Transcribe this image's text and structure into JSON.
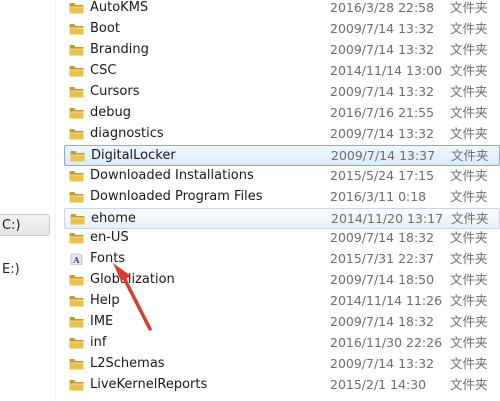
{
  "nav": {
    "items": [
      {
        "label": "C:)",
        "selected": true
      },
      {
        "label": "E:)",
        "selected": false
      }
    ]
  },
  "files": [
    {
      "name": "AutoKMS",
      "date": "2016/3/28 22:58",
      "type": "文件夹",
      "icon": "folder-icon",
      "state": ""
    },
    {
      "name": "Boot",
      "date": "2009/7/14 13:32",
      "type": "文件夹",
      "icon": "folder-icon",
      "state": ""
    },
    {
      "name": "Branding",
      "date": "2009/7/14 13:32",
      "type": "文件夹",
      "icon": "folder-icon",
      "state": ""
    },
    {
      "name": "CSC",
      "date": "2014/11/14 13:00",
      "type": "文件夹",
      "icon": "folder-icon",
      "state": ""
    },
    {
      "name": "Cursors",
      "date": "2009/7/14 13:32",
      "type": "文件夹",
      "icon": "folder-icon",
      "state": ""
    },
    {
      "name": "debug",
      "date": "2016/7/16 21:55",
      "type": "文件夹",
      "icon": "folder-icon",
      "state": ""
    },
    {
      "name": "diagnostics",
      "date": "2009/7/14 13:32",
      "type": "文件夹",
      "icon": "folder-icon",
      "state": ""
    },
    {
      "name": "DigitalLocker",
      "date": "2009/7/14 13:37",
      "type": "文件夹",
      "icon": "folder-icon",
      "state": "selected"
    },
    {
      "name": "Downloaded Installations",
      "date": "2015/5/24 17:15",
      "type": "文件夹",
      "icon": "folder-icon",
      "state": ""
    },
    {
      "name": "Downloaded Program Files",
      "date": "2016/3/11 0:18",
      "type": "文件夹",
      "icon": "folder-icon",
      "state": ""
    },
    {
      "name": "ehome",
      "date": "2014/11/20 13:17",
      "type": "文件夹",
      "icon": "folder-icon",
      "state": "hover"
    },
    {
      "name": "en-US",
      "date": "2009/7/14 18:32",
      "type": "文件夹",
      "icon": "folder-icon",
      "state": ""
    },
    {
      "name": "Fonts",
      "date": "2015/7/31 22:37",
      "type": "文件夹",
      "icon": "fonts-folder-icon",
      "state": ""
    },
    {
      "name": "Globalization",
      "date": "2009/7/14 18:50",
      "type": "文件夹",
      "icon": "folder-icon",
      "state": ""
    },
    {
      "name": "Help",
      "date": "2014/11/14 11:26",
      "type": "文件夹",
      "icon": "folder-icon",
      "state": ""
    },
    {
      "name": "IME",
      "date": "2009/7/14 18:32",
      "type": "文件夹",
      "icon": "folder-icon",
      "state": ""
    },
    {
      "name": "inf",
      "date": "2016/11/30 22:26",
      "type": "文件夹",
      "icon": "folder-icon",
      "state": ""
    },
    {
      "name": "L2Schemas",
      "date": "2009/7/14 13:32",
      "type": "文件夹",
      "icon": "folder-icon",
      "state": ""
    },
    {
      "name": "LiveKernelReports",
      "date": "2015/2/1 14:30",
      "type": "文件夹",
      "icon": "folder-icon",
      "state": ""
    }
  ],
  "colors": {
    "folder": "#e9c24c",
    "folder_dark": "#c89a28",
    "selection_border": "#84acdd",
    "annotation_arrow": "#e0392b"
  }
}
